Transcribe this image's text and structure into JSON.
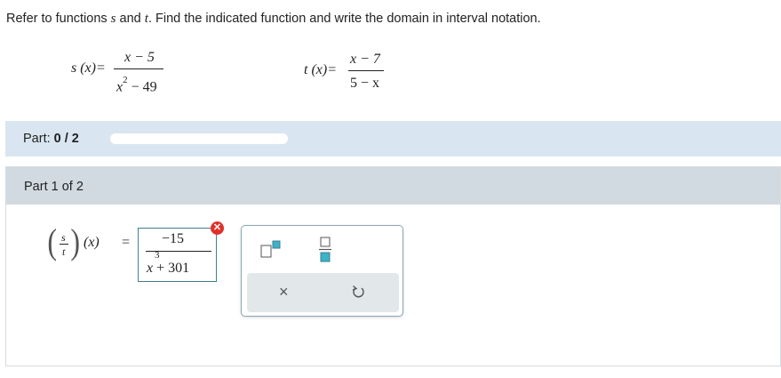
{
  "instructions": {
    "part1": "Refer to functions ",
    "var1": "s",
    "part2": " and ",
    "var2": "t",
    "part3": ". Find the indicated function and write the domain in interval notation."
  },
  "functions": {
    "s": {
      "lhs": "s (x)=",
      "numerator": "x − 5",
      "denominator_base": "x",
      "denominator_exp": "2",
      "denominator_rest": " − 49"
    },
    "t": {
      "lhs": "t (x)=",
      "numerator": "x − 7",
      "denominator": "5 − x"
    }
  },
  "progress": {
    "label": "Part:",
    "value": "0 / 2",
    "fraction": 0.0
  },
  "part_panel": {
    "header": "Part 1 of 2"
  },
  "expression": {
    "quotient_num": "s",
    "quotient_den": "t",
    "arg": "(x)",
    "equals": "="
  },
  "answer": {
    "numerator": "−15",
    "denominator_base": "x",
    "denominator_exp": "3",
    "denominator_rest": " + 301",
    "status": "incorrect"
  },
  "palette": {
    "tools": [
      "exponent-tool",
      "fraction-tool"
    ],
    "clear_symbol": "×",
    "undo_symbol": "↺"
  },
  "colors": {
    "progress_bar_bg": "#d9e6f1",
    "part_header_bg": "#d1dae0",
    "answer_border": "#3d7f91",
    "error": "#e0302a",
    "tool_accent": "#3bb3c9"
  }
}
